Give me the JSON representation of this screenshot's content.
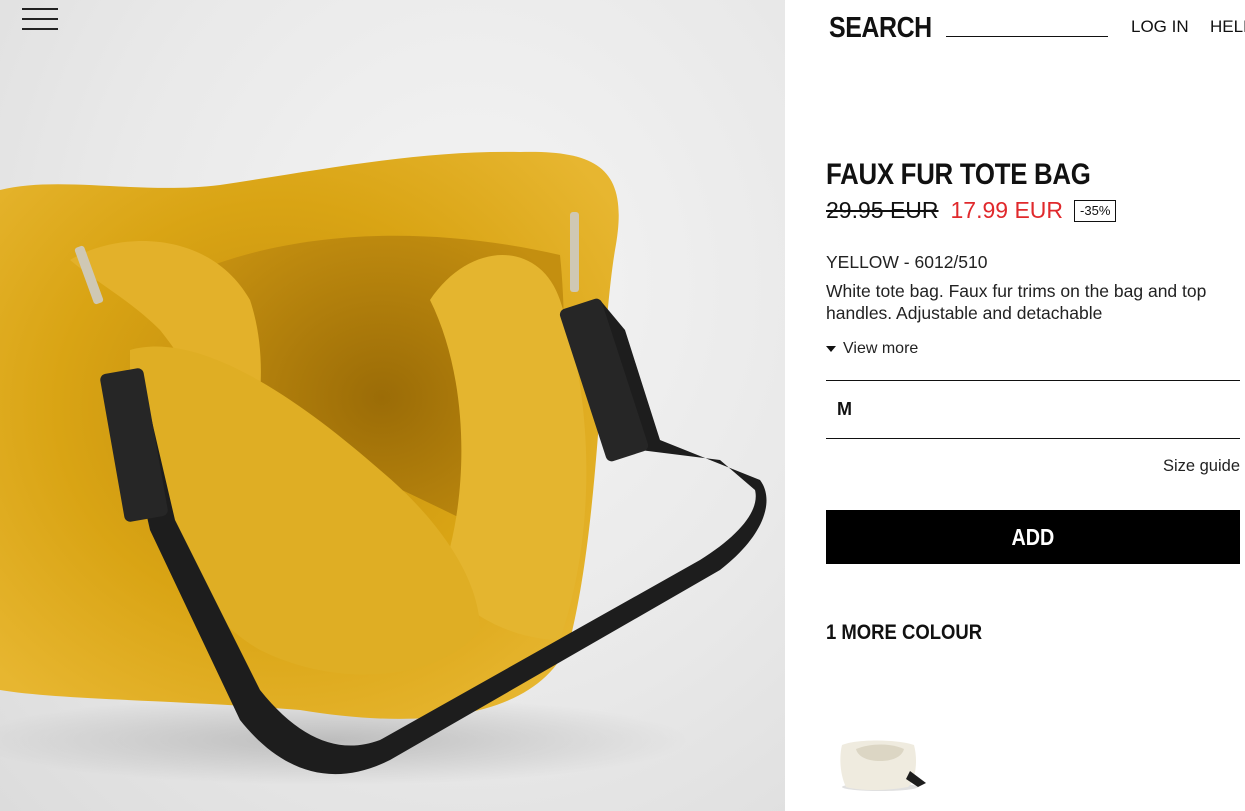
{
  "header": {
    "search_label": "SEARCH",
    "search_value": "",
    "login": "LOG IN",
    "help": "HELP"
  },
  "product": {
    "name": "FAUX FUR TOTE BAG",
    "old_price": "29.95 EUR",
    "new_price": "17.99 EUR",
    "discount": "-35%",
    "colour_ref": "YELLOW - 6012/510",
    "description": "White tote bag. Faux fur trims on the bag and top handles. Adjustable and detachable",
    "view_more": "View more",
    "selected_size": "M",
    "size_guide": "Size guide",
    "add_label": "ADD",
    "more_colours_label": "1 MORE COLOUR"
  },
  "colors": {
    "sale_red": "#e0292c",
    "bag_yellow": "#d9a414",
    "button_black": "#000000"
  }
}
